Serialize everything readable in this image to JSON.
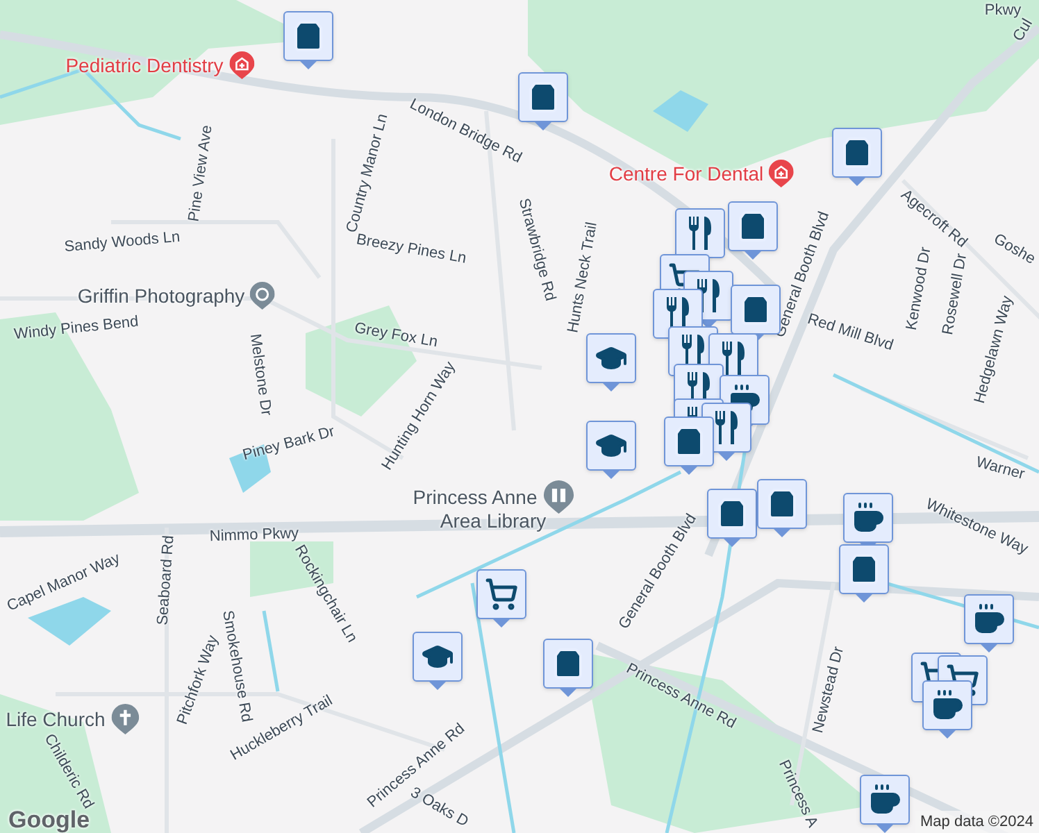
{
  "map": {
    "labels": [
      {
        "text": "Pediatric Dentistry",
        "kind": "medical"
      },
      {
        "text": "London Bridge Rd",
        "kind": "street"
      },
      {
        "text": "Country Manor Ln",
        "kind": "street"
      },
      {
        "text": "Pine View Ave",
        "kind": "street"
      },
      {
        "text": "Sandy Woods Ln",
        "kind": "street"
      },
      {
        "text": "Breezy Pines Ln",
        "kind": "street"
      },
      {
        "text": "Strawbridge Rd",
        "kind": "street"
      },
      {
        "text": "Hunts Neck Trail",
        "kind": "street"
      },
      {
        "text": "Griffin Photography",
        "kind": "business"
      },
      {
        "text": "Windy Pines Bend",
        "kind": "street"
      },
      {
        "text": "Grey Fox Ln",
        "kind": "street"
      },
      {
        "text": "Melstone Dr",
        "kind": "street"
      },
      {
        "text": "Piney Bark Dr",
        "kind": "street"
      },
      {
        "text": "Hunting Horn Way",
        "kind": "street"
      },
      {
        "text": "Princess Anne",
        "kind": "library"
      },
      {
        "text": "Area Library",
        "kind": "place"
      },
      {
        "text": "Nimmo Pkwy",
        "kind": "street"
      },
      {
        "text": "Centre For Dental",
        "kind": "medical"
      },
      {
        "text": "Agecroft Rd",
        "kind": "street"
      },
      {
        "text": "Kenwood Dr",
        "kind": "street"
      },
      {
        "text": "Rosewell Dr",
        "kind": "street"
      },
      {
        "text": "Goshe",
        "kind": "street"
      },
      {
        "text": "Hedgelawn Way",
        "kind": "street"
      },
      {
        "text": "General Booth Blvd",
        "kind": "street"
      },
      {
        "text": "Red Mill Blvd",
        "kind": "street"
      },
      {
        "text": "Warner",
        "kind": "street"
      },
      {
        "text": "Whitestone Way",
        "kind": "street"
      },
      {
        "text": "General Booth Blvd",
        "kind": "street"
      },
      {
        "text": "Capel Manor Way",
        "kind": "street"
      },
      {
        "text": "Seaboard Rd",
        "kind": "street"
      },
      {
        "text": "Rockingchair Ln",
        "kind": "street"
      },
      {
        "text": "Pitchfork Way",
        "kind": "street"
      },
      {
        "text": "Smokehouse Rd",
        "kind": "street"
      },
      {
        "text": "Life Church",
        "kind": "church"
      },
      {
        "text": "Childeric Rd",
        "kind": "street"
      },
      {
        "text": "Huckleberry Trail",
        "kind": "street"
      },
      {
        "text": "Princess Anne Rd",
        "kind": "street"
      },
      {
        "text": "Princess Anne Rd",
        "kind": "street"
      },
      {
        "text": "Newstead Dr",
        "kind": "street"
      },
      {
        "text": "3 Oaks D",
        "kind": "street"
      },
      {
        "text": "Princess A",
        "kind": "street"
      },
      {
        "text": "Cul",
        "kind": "street"
      },
      {
        "text": "Pkwy",
        "kind": "street"
      }
    ],
    "markers": [
      {
        "kind": "shopping"
      },
      {
        "kind": "shopping"
      },
      {
        "kind": "shopping"
      },
      {
        "kind": "shopping"
      },
      {
        "kind": "dining"
      },
      {
        "kind": "grocery"
      },
      {
        "kind": "dining"
      },
      {
        "kind": "dining"
      },
      {
        "kind": "shopping"
      },
      {
        "kind": "school"
      },
      {
        "kind": "dining"
      },
      {
        "kind": "dining"
      },
      {
        "kind": "dining"
      },
      {
        "kind": "coffee"
      },
      {
        "kind": "dining"
      },
      {
        "kind": "dining"
      },
      {
        "kind": "school"
      },
      {
        "kind": "shopping"
      },
      {
        "kind": "shopping"
      },
      {
        "kind": "shopping"
      },
      {
        "kind": "coffee"
      },
      {
        "kind": "shopping"
      },
      {
        "kind": "grocery"
      },
      {
        "kind": "school"
      },
      {
        "kind": "shopping"
      },
      {
        "kind": "coffee"
      },
      {
        "kind": "grocery"
      },
      {
        "kind": "grocery"
      },
      {
        "kind": "coffee"
      },
      {
        "kind": "coffee"
      }
    ]
  },
  "logo": "Google",
  "attribution": "Map data ©2024"
}
